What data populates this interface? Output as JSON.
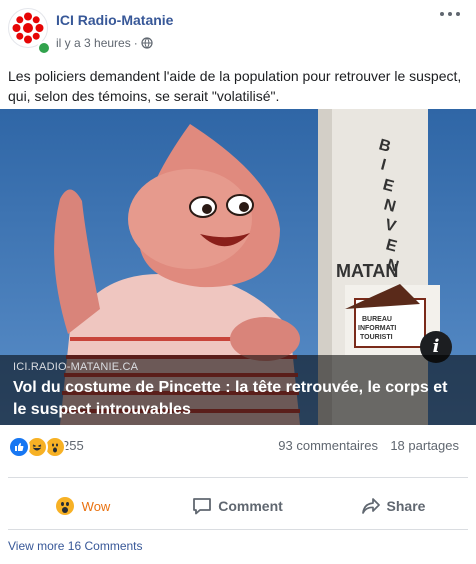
{
  "post": {
    "page_name": "ICI Radio-Matanie",
    "timestamp": "il y a 3 heures",
    "separator": "·",
    "privacy_icon": "globe-icon",
    "text": "Les policiers demandent l'aide de la population pour retrouver le suspect, qui, selon des témoins, se serait \"volatilisé\"."
  },
  "link": {
    "domain": "ICI.RADIO-MATANIE.CA",
    "title": "Vol du costume de Pincette : la tête retrouvée, le corps et le suspect introuvables",
    "info_label": "i",
    "sign_text": "BIENVENUE À MATANE",
    "sign_small": "BUREAU INFORMATION TOURISTIQUE"
  },
  "reactions": {
    "icons": [
      "like-icon",
      "haha-icon",
      "wow-icon"
    ],
    "count": "255",
    "comments": "93 commentaires",
    "shares": "18 partages"
  },
  "actions": {
    "wow_label": "Wow",
    "comment_label": "Comment",
    "share_label": "Share"
  },
  "footer": {
    "view_more": "View more 16 Comments"
  },
  "colors": {
    "link_blue": "#385898",
    "wow_orange": "#e9710f",
    "like_blue": "#1877f2",
    "online_green": "#31a24c"
  }
}
